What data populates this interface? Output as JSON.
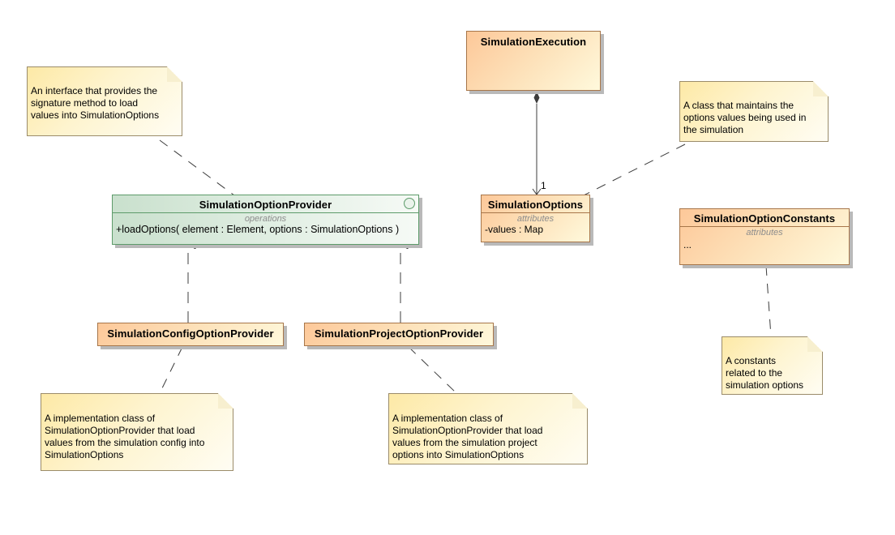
{
  "diagram": {
    "type": "UML class diagram",
    "classes": {
      "simulation_execution": {
        "name": "SimulationExecution"
      },
      "simulation_options": {
        "name": "SimulationOptions",
        "compartment_label": "attributes",
        "attributes": [
          "-values : Map"
        ]
      },
      "simulation_option_constants": {
        "name": "SimulationOptionConstants",
        "compartment_label": "attributes",
        "attributes": [
          "..."
        ]
      },
      "simulation_config_option_provider": {
        "name": "SimulationConfigOptionProvider"
      },
      "simulation_project_option_provider": {
        "name": "SimulationProjectOptionProvider"
      }
    },
    "interfaces": {
      "simulation_option_provider": {
        "name": "SimulationOptionProvider",
        "compartment_label": "operations",
        "operations": [
          "+loadOptions( element : Element, options : SimulationOptions )"
        ]
      }
    },
    "notes": {
      "provider_note": [
        "An interface that provides the",
        "signature method to load",
        "values into SimulationOptions"
      ],
      "options_note": [
        "A class that maintains the",
        "options values being used in",
        "the simulation"
      ],
      "constants_note": [
        "A constants",
        "related to the",
        "simulation options"
      ],
      "config_note": [
        "A implementation class of",
        "SimulationOptionProvider that load",
        "values from the simulation config into",
        "SimulationOptions"
      ],
      "project_note": [
        "A implementation class of",
        "SimulationOptionProvider that load",
        "values from the simulation project",
        "options into SimulationOptions"
      ]
    },
    "relationships": {
      "composition": {
        "from": "SimulationExecution",
        "to": "SimulationOptions",
        "multiplicity": "1"
      },
      "realizations": [
        {
          "from": "SimulationConfigOptionProvider",
          "to": "SimulationOptionProvider"
        },
        {
          "from": "SimulationProjectOptionProvider",
          "to": "SimulationOptionProvider"
        }
      ]
    },
    "colors": {
      "class_fill_start": "#fdc899",
      "class_fill_end": "#fff9dc",
      "interface_fill_start": "#c9e0cd",
      "note_fill": "#fef4cf",
      "line": "#3c3c3c"
    }
  }
}
